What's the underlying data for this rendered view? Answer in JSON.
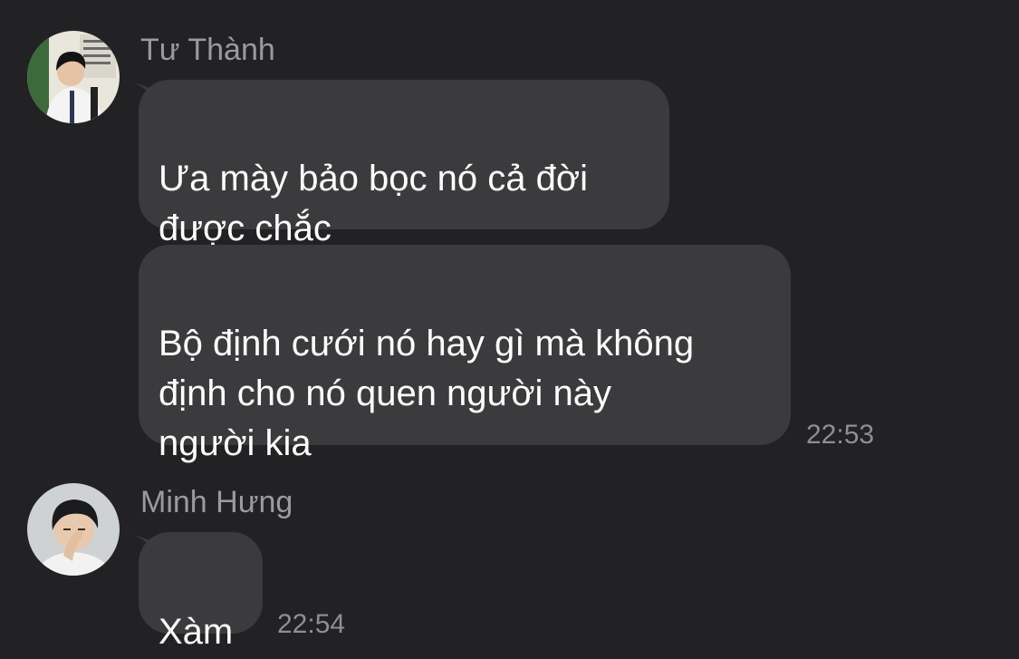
{
  "messages": [
    {
      "sender": "Tư Thành",
      "avatar": "avatar-tu-thanh",
      "bubbles": [
        "Ưa mày bảo bọc nó cả đời\nđược chắc",
        "Bộ định cưới nó hay gì mà không\nđịnh cho nó quen người này\nngười kia"
      ],
      "time": "22:53"
    },
    {
      "sender": "Minh Hưng",
      "avatar": "avatar-minh-hung",
      "bubbles": [
        "Xàm"
      ],
      "time": "22:54"
    }
  ],
  "colors": {
    "background": "#222224",
    "bubble": "#3b3b3d",
    "sender_name": "#9a9a9f",
    "timestamp": "#8e8e93",
    "text": "#ffffff"
  }
}
